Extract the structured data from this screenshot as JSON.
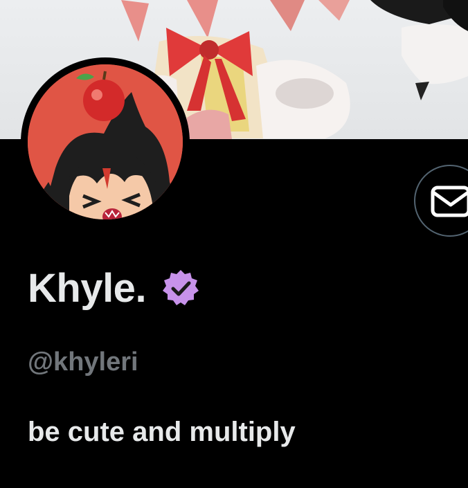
{
  "profile": {
    "display_name": "Khyle.",
    "handle": "@khyleri",
    "bio": "be cute and multiply",
    "verified": true,
    "verified_badge_color": "#c792ea"
  },
  "actions": {
    "message_icon": "mail-icon"
  },
  "colors": {
    "background": "#000000",
    "primary_text": "#e7e9ea",
    "secondary_text": "#71767b",
    "button_border": "#536471"
  }
}
